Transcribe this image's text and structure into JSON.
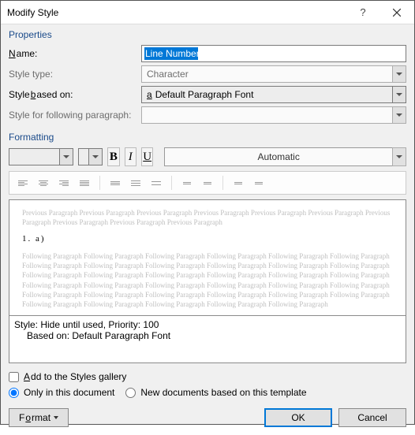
{
  "title": "Modify Style",
  "section_properties": "Properties",
  "section_formatting": "Formatting",
  "labels": {
    "name_pre": "",
    "name_u": "N",
    "name_post": "ame:",
    "styletype": "Style type:",
    "basedon_pre": "Style ",
    "basedon_u": "b",
    "basedon_post": "ased on:",
    "following": "Style for following paragraph:"
  },
  "fields": {
    "name": "Line Number",
    "style_type": "Character",
    "based_on": "Default Paragraph Font",
    "following": ""
  },
  "preview": {
    "prev": "Previous Paragraph Previous Paragraph Previous Paragraph Previous Paragraph Previous Paragraph Previous Paragraph Previous Paragraph Previous Paragraph Previous Paragraph Previous Paragraph",
    "sample": "1.        a)",
    "follow": "Following Paragraph Following Paragraph Following Paragraph Following Paragraph Following Paragraph Following Paragraph Following Paragraph Following Paragraph Following Paragraph Following Paragraph Following Paragraph Following Paragraph Following Paragraph Following Paragraph Following Paragraph Following Paragraph Following Paragraph Following Paragraph Following Paragraph Following Paragraph Following Paragraph Following Paragraph Following Paragraph Following Paragraph Following Paragraph Following Paragraph Following Paragraph Following Paragraph Following Paragraph Following Paragraph Following Paragraph Following Paragraph Following Paragraph Following Paragraph Following Paragraph"
  },
  "description": {
    "line1": "Style: Hide until used, Priority: 100",
    "line2": "Based on: Default Paragraph Font"
  },
  "color_auto": "Automatic",
  "checkbox_add_pre": "",
  "checkbox_add_u": "A",
  "checkbox_add_post": "dd to the Styles gallery",
  "radio_only": "Only in this document",
  "radio_new": "New documents based on this template",
  "btn_format_pre": "F",
  "btn_format_u": "o",
  "btn_format_post": "rmat",
  "btn_ok": "OK",
  "btn_cancel": "Cancel",
  "glyph_a": "a"
}
